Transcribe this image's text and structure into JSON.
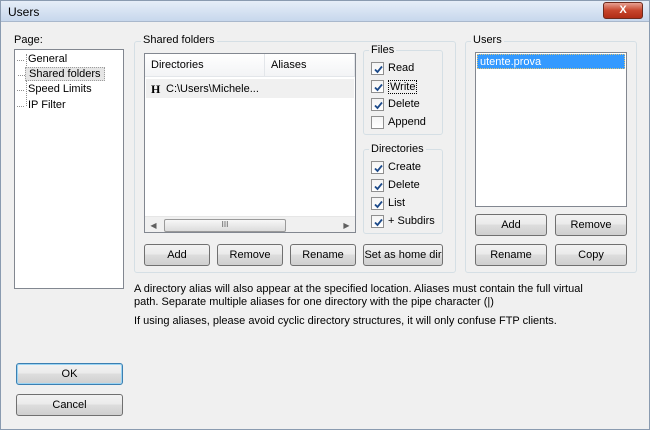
{
  "window": {
    "title": "Users",
    "close_label": "X"
  },
  "page_nav": {
    "label": "Page:",
    "items": [
      "General",
      "Shared folders",
      "Speed Limits",
      "IP Filter"
    ],
    "selected": "Shared folders"
  },
  "shared_folders": {
    "title": "Shared folders",
    "columns": [
      "Directories",
      "Aliases"
    ],
    "rows": [
      {
        "icon": "H",
        "directory": "C:\\Users\\Michele...",
        "aliases": ""
      }
    ],
    "scroll_thumb": "III",
    "buttons": {
      "add": "Add",
      "remove": "Remove",
      "rename": "Rename",
      "set_home": "Set as home dir"
    }
  },
  "files": {
    "title": "Files",
    "options": [
      {
        "label": "Read",
        "checked": true
      },
      {
        "label": "Write",
        "checked": true
      },
      {
        "label": "Delete",
        "checked": true
      },
      {
        "label": "Append",
        "checked": false
      }
    ]
  },
  "directories": {
    "title": "Directories",
    "options": [
      {
        "label": "Create",
        "checked": true
      },
      {
        "label": "Delete",
        "checked": true
      },
      {
        "label": "List",
        "checked": true
      },
      {
        "label": "+ Subdirs",
        "checked": true
      }
    ]
  },
  "users": {
    "title": "Users",
    "items": [
      "utente.prova"
    ],
    "buttons": {
      "add": "Add",
      "remove": "Remove",
      "rename": "Rename",
      "copy": "Copy"
    }
  },
  "info": {
    "line1": "A directory alias will also appear at the specified location. Aliases must contain the full virtual",
    "line2": "path. Separate multiple aliases for one directory with the pipe character (|)",
    "line3": "If using aliases, please avoid cyclic directory structures, it will only confuse FTP clients."
  },
  "dialog_buttons": {
    "ok": "OK",
    "cancel": "Cancel"
  }
}
